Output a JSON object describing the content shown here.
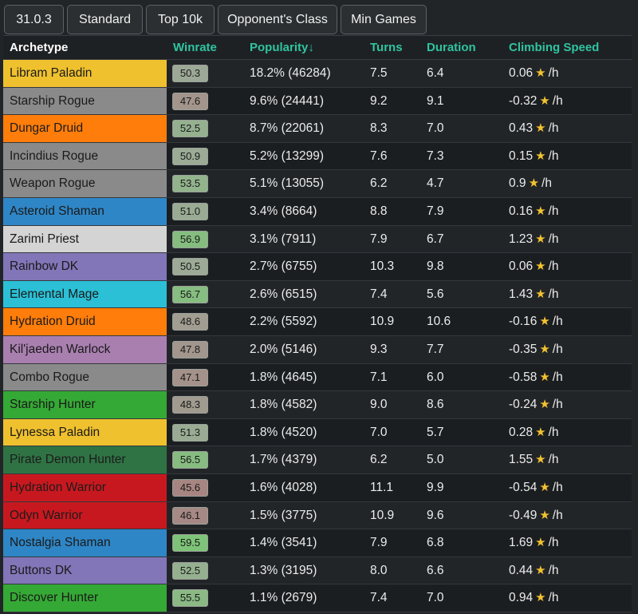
{
  "filters": [
    {
      "label": "31.0.3"
    },
    {
      "label": "Standard"
    },
    {
      "label": "Top 10k"
    },
    {
      "label": "Opponent's Class"
    },
    {
      "label": "Min Games"
    }
  ],
  "columns": {
    "archetype": "Archetype",
    "winrate": "Winrate",
    "popularity": "Popularity↓",
    "turns": "Turns",
    "duration": "Duration",
    "climbing": "Climbing Speed"
  },
  "unit_suffix": "/h",
  "star_icon": "star-icon",
  "colors": {
    "paladin": "#f0c12e",
    "rogue": "#8a8a8a",
    "druid": "#ff7d0a",
    "shaman": "#2f86c6",
    "priest": "#d4d4d4",
    "dk": "#8276b8",
    "mage": "#2bc0d6",
    "warlock": "#a97fb0",
    "hunter": "#35a935",
    "demon_hunter": "#2f7344",
    "warrior": "#c8181f",
    "header_accent": "#2fc4a0"
  },
  "rows": [
    {
      "name": "Libram Paladin",
      "cls": "paladin",
      "winrate": "50.3",
      "popularity": "18.2% (46284)",
      "turns": "7.5",
      "duration": "6.4",
      "climbing": "0.06"
    },
    {
      "name": "Starship Rogue",
      "cls": "rogue",
      "winrate": "47.6",
      "popularity": "9.6% (24441)",
      "turns": "9.2",
      "duration": "9.1",
      "climbing": "-0.32"
    },
    {
      "name": "Dungar Druid",
      "cls": "druid",
      "winrate": "52.5",
      "popularity": "8.7% (22061)",
      "turns": "8.3",
      "duration": "7.0",
      "climbing": "0.43"
    },
    {
      "name": "Incindius Rogue",
      "cls": "rogue",
      "winrate": "50.9",
      "popularity": "5.2% (13299)",
      "turns": "7.6",
      "duration": "7.3",
      "climbing": "0.15"
    },
    {
      "name": "Weapon Rogue",
      "cls": "rogue",
      "winrate": "53.5",
      "popularity": "5.1% (13055)",
      "turns": "6.2",
      "duration": "4.7",
      "climbing": "0.9"
    },
    {
      "name": "Asteroid Shaman",
      "cls": "shaman",
      "winrate": "51.0",
      "popularity": "3.4% (8664)",
      "turns": "8.8",
      "duration": "7.9",
      "climbing": "0.16"
    },
    {
      "name": "Zarimi Priest",
      "cls": "priest",
      "winrate": "56.9",
      "popularity": "3.1% (7911)",
      "turns": "7.9",
      "duration": "6.7",
      "climbing": "1.23"
    },
    {
      "name": "Rainbow DK",
      "cls": "dk",
      "winrate": "50.5",
      "popularity": "2.7% (6755)",
      "turns": "10.3",
      "duration": "9.8",
      "climbing": "0.06"
    },
    {
      "name": "Elemental Mage",
      "cls": "mage",
      "winrate": "56.7",
      "popularity": "2.6% (6515)",
      "turns": "7.4",
      "duration": "5.6",
      "climbing": "1.43"
    },
    {
      "name": "Hydration Druid",
      "cls": "druid",
      "winrate": "48.6",
      "popularity": "2.2% (5592)",
      "turns": "10.9",
      "duration": "10.6",
      "climbing": "-0.16"
    },
    {
      "name": "Kil'jaeden Warlock",
      "cls": "warlock",
      "winrate": "47.8",
      "popularity": "2.0% (5146)",
      "turns": "9.3",
      "duration": "7.7",
      "climbing": "-0.35"
    },
    {
      "name": "Combo Rogue",
      "cls": "rogue",
      "winrate": "47.1",
      "popularity": "1.8% (4645)",
      "turns": "7.1",
      "duration": "6.0",
      "climbing": "-0.58"
    },
    {
      "name": "Starship Hunter",
      "cls": "hunter",
      "winrate": "48.3",
      "popularity": "1.8% (4582)",
      "turns": "9.0",
      "duration": "8.6",
      "climbing": "-0.24"
    },
    {
      "name": "Lynessa Paladin",
      "cls": "paladin",
      "winrate": "51.3",
      "popularity": "1.8% (4520)",
      "turns": "7.0",
      "duration": "5.7",
      "climbing": "0.28"
    },
    {
      "name": "Pirate Demon Hunter",
      "cls": "demon_hunter",
      "winrate": "56.5",
      "popularity": "1.7% (4379)",
      "turns": "6.2",
      "duration": "5.0",
      "climbing": "1.55"
    },
    {
      "name": "Hydration Warrior",
      "cls": "warrior",
      "winrate": "45.6",
      "popularity": "1.6% (4028)",
      "turns": "11.1",
      "duration": "9.9",
      "climbing": "-0.54"
    },
    {
      "name": "Odyn Warrior",
      "cls": "warrior",
      "winrate": "46.1",
      "popularity": "1.5% (3775)",
      "turns": "10.9",
      "duration": "9.6",
      "climbing": "-0.49"
    },
    {
      "name": "Nostalgia Shaman",
      "cls": "shaman",
      "winrate": "59.5",
      "popularity": "1.4% (3541)",
      "turns": "7.9",
      "duration": "6.8",
      "climbing": "1.69"
    },
    {
      "name": "Buttons DK",
      "cls": "dk",
      "winrate": "52.5",
      "popularity": "1.3% (3195)",
      "turns": "8.0",
      "duration": "6.6",
      "climbing": "0.44"
    },
    {
      "name": "Discover Hunter",
      "cls": "hunter",
      "winrate": "55.5",
      "popularity": "1.1% (2679)",
      "turns": "7.4",
      "duration": "7.0",
      "climbing": "0.94"
    }
  ]
}
